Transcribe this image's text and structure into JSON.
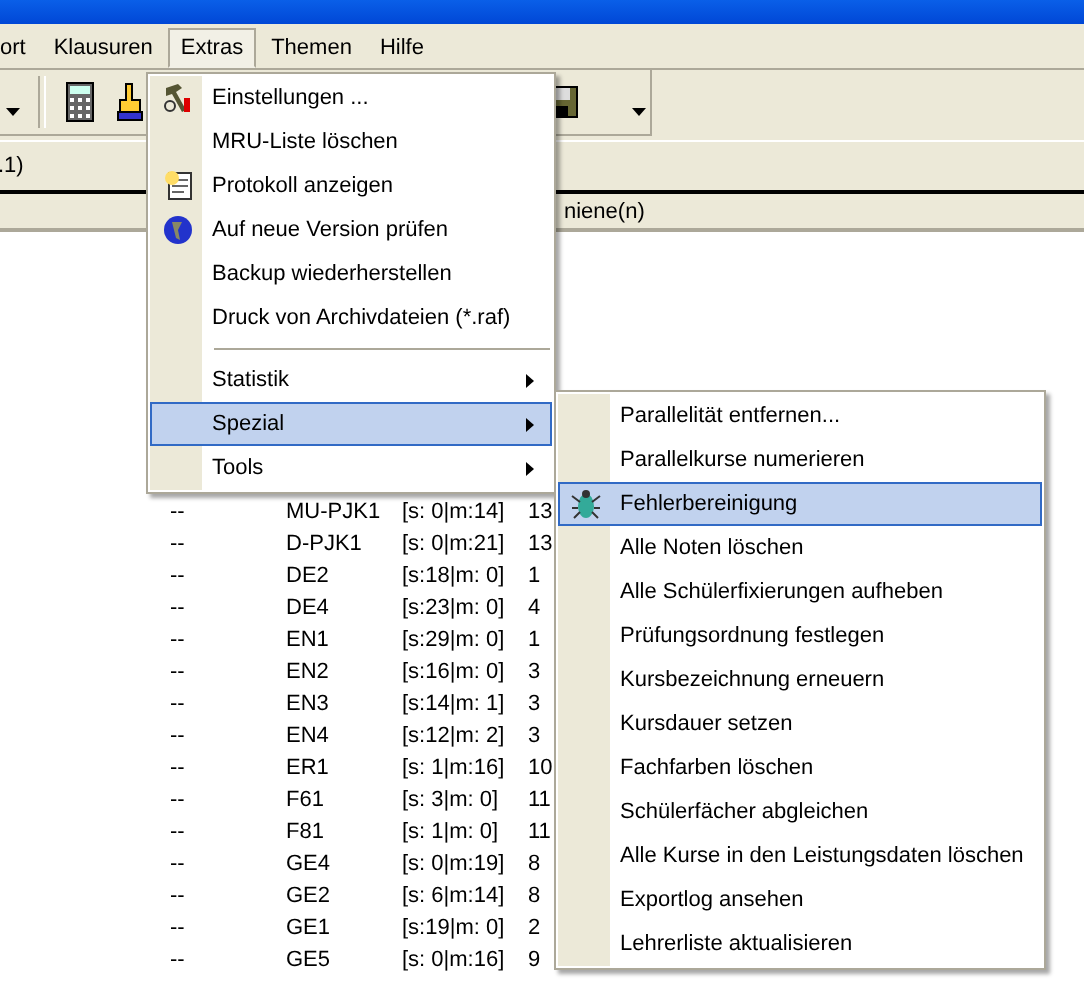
{
  "menu_bar": [
    {
      "label": "ort",
      "selected": false
    },
    {
      "label": "Klausuren",
      "selected": false
    },
    {
      "label": "Extras",
      "selected": true
    },
    {
      "label": "Themen",
      "selected": false
    },
    {
      "label": "Hilfe",
      "selected": false
    }
  ],
  "address_bar": {
    "text": ".1)"
  },
  "list_header": {
    "column_5": "niene(n)"
  },
  "rows": [
    {
      "column_1": "--",
      "column_2": "MU-PJK1",
      "column_3": "[s: 0|m:14]",
      "column_4": "13"
    },
    {
      "column_1": "--",
      "column_2": "D-PJK1",
      "column_3": "[s: 0|m:21]",
      "column_4": "13"
    },
    {
      "column_1": "--",
      "column_2": "DE2",
      "column_3": "[s:18|m: 0]",
      "column_4": "1"
    },
    {
      "column_1": "--",
      "column_2": "DE4",
      "column_3": "[s:23|m: 0]",
      "column_4": "4"
    },
    {
      "column_1": "--",
      "column_2": "EN1",
      "column_3": "[s:29|m: 0]",
      "column_4": "1"
    },
    {
      "column_1": "--",
      "column_2": "EN2",
      "column_3": "[s:16|m: 0]",
      "column_4": "3"
    },
    {
      "column_1": "--",
      "column_2": "EN3",
      "column_3": "[s:14|m: 1]",
      "column_4": "3"
    },
    {
      "column_1": "--",
      "column_2": "EN4",
      "column_3": "[s:12|m: 2]",
      "column_4": "3"
    },
    {
      "column_1": "--",
      "column_2": "ER1",
      "column_3": "[s: 1|m:16]",
      "column_4": "10"
    },
    {
      "column_1": "--",
      "column_2": "F61",
      "column_3": "[s: 3|m: 0]",
      "column_4": "11"
    },
    {
      "column_1": "--",
      "column_2": "F81",
      "column_3": "[s: 1|m: 0]",
      "column_4": "11"
    },
    {
      "column_1": "--",
      "column_2": "GE4",
      "column_3": "[s: 0|m:19]",
      "column_4": "8"
    },
    {
      "column_1": "--",
      "column_2": "GE2",
      "column_3": "[s: 6|m:14]",
      "column_4": "8"
    },
    {
      "column_1": "--",
      "column_2": "GE1",
      "column_3": "[s:19|m: 0]",
      "column_4": "2"
    },
    {
      "column_1": "--",
      "column_2": "GE5",
      "column_3": "[s: 0|m:16]",
      "column_4": "9"
    }
  ],
  "extras_menu": [
    {
      "kind": "item",
      "label": "Einstellungen ...",
      "has_icon": true,
      "selected": false
    },
    {
      "kind": "item",
      "label": "MRU-Liste löschen",
      "selected": false
    },
    {
      "kind": "item",
      "label": "Protokoll anzeigen",
      "has_icon": true,
      "selected": false
    },
    {
      "kind": "item",
      "label": "Auf neue Version prüfen",
      "has_icon": true,
      "selected": false
    },
    {
      "kind": "item",
      "label": "Backup wiederherstellen",
      "selected": false
    },
    {
      "kind": "item",
      "label": "Druck von Archivdateien (*.raf)",
      "selected": false
    },
    {
      "kind": "separator"
    },
    {
      "kind": "submenu",
      "label": "Statistik",
      "selected": false
    },
    {
      "kind": "submenu",
      "label": "Spezial",
      "selected": true
    },
    {
      "kind": "submenu",
      "label": "Tools",
      "selected": false
    }
  ],
  "special_submenu": [
    {
      "kind": "item",
      "label": "Parallelität entfernen...",
      "selected": false
    },
    {
      "kind": "item",
      "label": "Parallelkurse numerieren",
      "selected": false
    },
    {
      "kind": "item",
      "label": "Fehlerbereinigung",
      "has_icon": true,
      "selected": true
    },
    {
      "kind": "item",
      "label": "Alle Noten löschen",
      "selected": false
    },
    {
      "kind": "item",
      "label": "Alle Schülerfixierungen aufheben",
      "selected": false
    },
    {
      "kind": "item",
      "label": "Prüfungsordnung festlegen",
      "selected": false
    },
    {
      "kind": "item",
      "label": "Kursbezeichnung erneuern",
      "selected": false
    },
    {
      "kind": "item",
      "label": "Kursdauer setzen",
      "selected": false
    },
    {
      "kind": "item",
      "label": "Fachfarben löschen",
      "selected": false
    },
    {
      "kind": "item",
      "label": "Schülerfächer abgleichen",
      "selected": false
    },
    {
      "kind": "item",
      "label": "Alle Kurse in den Leistungsdaten löschen",
      "selected": false
    },
    {
      "kind": "item",
      "label": "Exportlog ansehen",
      "selected": false
    },
    {
      "kind": "item",
      "label": "Lehrerliste aktualisieren",
      "selected": false
    }
  ]
}
